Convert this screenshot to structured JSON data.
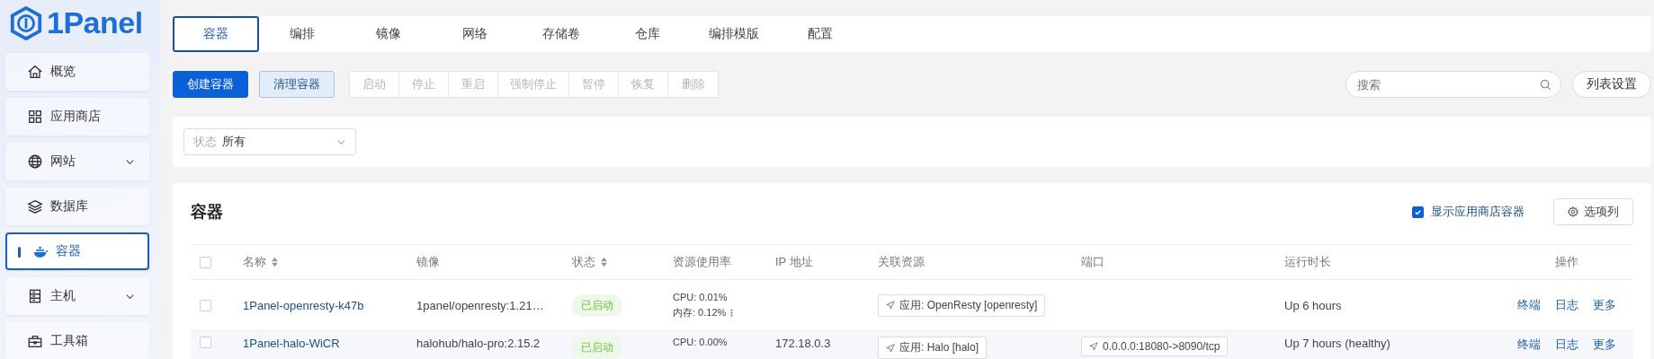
{
  "brand": {
    "name": "1Panel"
  },
  "sidebar": {
    "items": [
      {
        "label": "概览",
        "expandable": false,
        "selected": false
      },
      {
        "label": "应用商店",
        "expandable": false,
        "selected": false
      },
      {
        "label": "网站",
        "expandable": true,
        "selected": false
      },
      {
        "label": "数据库",
        "expandable": false,
        "selected": false
      },
      {
        "label": "容器",
        "expandable": false,
        "selected": true
      },
      {
        "label": "主机",
        "expandable": true,
        "selected": false
      },
      {
        "label": "工具箱",
        "expandable": false,
        "selected": false
      }
    ]
  },
  "tabs": [
    {
      "label": "容器",
      "selected": true
    },
    {
      "label": "编排",
      "selected": false
    },
    {
      "label": "镜像",
      "selected": false
    },
    {
      "label": "网络",
      "selected": false
    },
    {
      "label": "存储卷",
      "selected": false
    },
    {
      "label": "仓库",
      "selected": false
    },
    {
      "label": "编排模版",
      "selected": false
    },
    {
      "label": "配置",
      "selected": false
    }
  ],
  "toolbar": {
    "primary": "创建容器",
    "secondary": "清理容器",
    "actions": [
      {
        "label": "启动",
        "disabled": true
      },
      {
        "label": "停止",
        "disabled": true
      },
      {
        "label": "重启",
        "disabled": true
      },
      {
        "label": "强制停止",
        "disabled": true
      },
      {
        "label": "暂停",
        "disabled": true
      },
      {
        "label": "恢复",
        "disabled": true
      },
      {
        "label": "删除",
        "disabled": true
      }
    ],
    "search": {
      "placeholder": "搜索"
    },
    "settings": "列表设置"
  },
  "filter": {
    "label": "状态",
    "value": "所有"
  },
  "table": {
    "title": "容器",
    "show_store": {
      "label": "显示应用商店容器",
      "checked": true
    },
    "columns_button": "选项列",
    "select_all": {
      "checked": false
    },
    "columns": [
      {
        "label": "名称",
        "sortable": true
      },
      {
        "label": "镜像",
        "sortable": false
      },
      {
        "label": "状态",
        "sortable": true
      },
      {
        "label": "资源使用率",
        "sortable": false
      },
      {
        "label": "IP 地址",
        "sortable": false
      },
      {
        "label": "关联资源",
        "sortable": false
      },
      {
        "label": "端口",
        "sortable": false
      },
      {
        "label": "运行时长",
        "sortable": false
      },
      {
        "label": "操作",
        "sortable": false
      }
    ],
    "rows": [
      {
        "checked": false,
        "hovered": false,
        "name": "1Panel-openresty-k47b",
        "image": "1panel/openresty:1.21…",
        "status": "已启动",
        "cpu": "CPU: 0.01%",
        "memory": "内存: 0.12%",
        "resource": "应用: OpenResty [openresty]",
        "uptime": "Up 6 hours",
        "actions": [
          "终端",
          "日志",
          "更多"
        ]
      },
      {
        "checked": false,
        "hovered": true,
        "name": "1Panel-halo-WiCR",
        "image": "halohub/halo-pro:2.15.2",
        "status": "已启动",
        "cpu": "CPU: 0.00%",
        "ip": "172.18.0.3",
        "resource": "应用: Halo [halo]",
        "port": "0.0.0.0:18080->8090/tcp",
        "uptime": "Up 7 hours (healthy)",
        "actions": [
          "终端",
          "日志",
          "更多"
        ]
      }
    ]
  }
}
